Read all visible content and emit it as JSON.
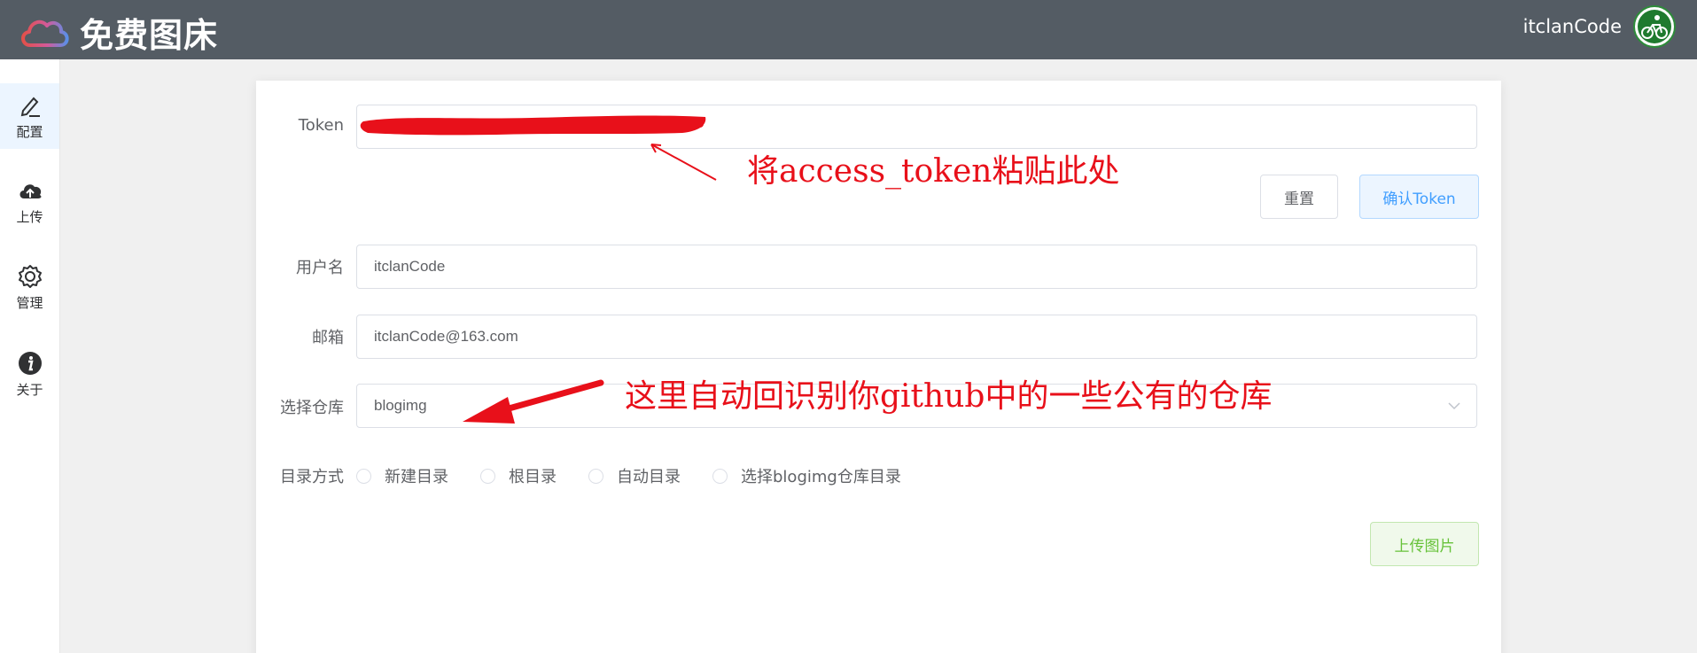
{
  "header": {
    "logo_text": "免费图床",
    "user_name": "itclanCode",
    "background": "#545c64"
  },
  "sidebar": {
    "items": [
      {
        "label": "配置",
        "icon": "edit-icon",
        "active": true
      },
      {
        "label": "上传",
        "icon": "cloud-upload-icon",
        "active": false
      },
      {
        "label": "管理",
        "icon": "gear-icon",
        "active": false
      },
      {
        "label": "关于",
        "icon": "info-icon",
        "active": false
      }
    ]
  },
  "form": {
    "token_label": "Token",
    "token_value": "",
    "reset_label": "重置",
    "confirm_label": "确认Token",
    "username_label": "用户名",
    "username_value": "itclanCode",
    "email_label": "邮箱",
    "email_value": "itclanCode@163.com",
    "repo_label": "选择仓库",
    "repo_value": "blogimg",
    "dir_label": "目录方式",
    "dir_options": [
      "新建目录",
      "根目录",
      "自动目录",
      "选择blogimg仓库目录"
    ],
    "upload_label": "上传图片"
  },
  "annotations": {
    "token_note": "将access_token粘贴此处",
    "repo_note": "这里自动回识别你github中的一些公有的仓库",
    "color": "#e8101a"
  },
  "colors": {
    "primary": "#409eff",
    "success": "#67c23a",
    "border": "#dcdfe6"
  }
}
